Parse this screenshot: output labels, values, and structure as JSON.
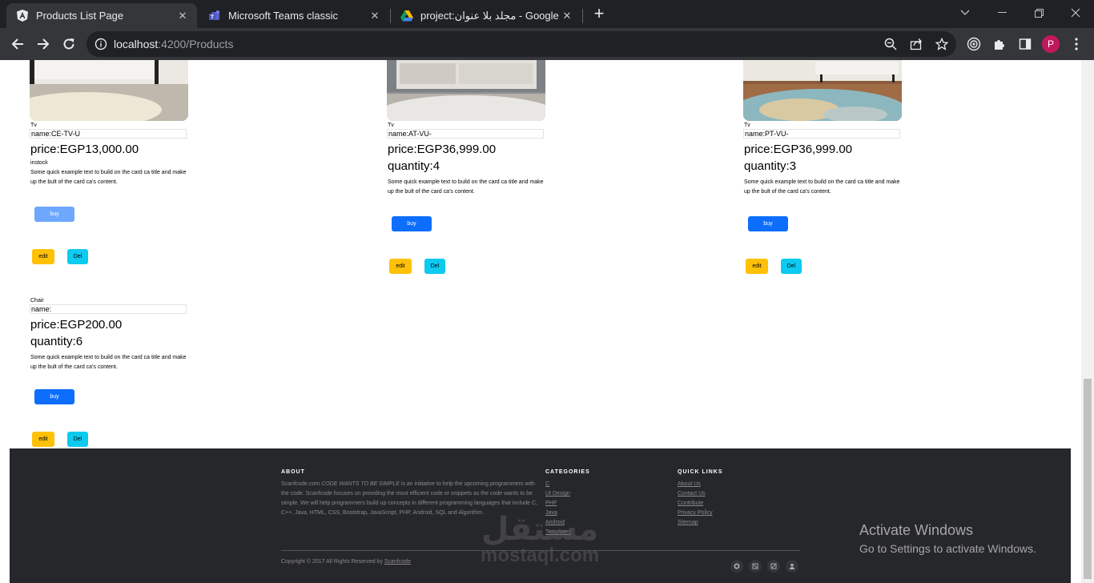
{
  "browser": {
    "tabs": [
      {
        "title": "Products List Page",
        "favicon": "angular-icon",
        "active": true
      },
      {
        "title": "Microsoft Teams classic",
        "favicon": "teams-icon",
        "active": false
      },
      {
        "title": "project:مجلد بلا عنوان - Google Dr",
        "favicon": "google-drive-icon",
        "active": false
      }
    ],
    "url_host": "localhost",
    "url_rest": ":4200/Products",
    "profile_initial": "P"
  },
  "products": [
    {
      "category": "Tv",
      "name": "name:CE-TV-U",
      "price": "price:EGP13,000.00",
      "quantity": "",
      "stock": "instock",
      "description": "Some quick example text to build on the card ca title and make up the bult of the card ca's content.",
      "buy_label": "buy",
      "edit_label": "edit",
      "del_label": "Del"
    },
    {
      "category": "Tv",
      "name": "name:AT-VU-",
      "price": "price:EGP36,999.00",
      "quantity": "quantity:4",
      "stock": "",
      "description": "Some quick example text to build on the card ca title and make up the bult of the card ca's content.",
      "buy_label": "buy",
      "edit_label": "edit",
      "del_label": "Del"
    },
    {
      "category": "Tv",
      "name": "name:PT-VU-",
      "price": "price:EGP36,999.00",
      "quantity": "quantity:3",
      "stock": "",
      "description": "Some quick example text to build on the card ca title and make up the bult of the card ca's content.",
      "buy_label": "buy",
      "edit_label": "edit",
      "del_label": "Del"
    },
    {
      "category": "Chair",
      "name": "name:",
      "price": "price:EGP200.00",
      "quantity": "quantity:6",
      "stock": "",
      "description": "Some quick example text to build on the card ca title and make up the bult of the card ca's content.",
      "buy_label": "buy",
      "edit_label": "edit",
      "del_label": "Del"
    }
  ],
  "footer": {
    "about_heading": "ABOUT",
    "about_text_1": "Scanfcode.com ",
    "about_text_em": "CODE WANTS TO BE SIMPLE",
    "about_text_2": " is an initiative to help the upcoming programmers with the code. Scanfcode focuses on providing the most efficient code or snippets as the code wants to be simple. We will help programmers build up concepts in different programming languages that include C, C++, Java, HTML, CSS, Bootstrap, JavaScript, PHP, Android, SQL and Algorithm.",
    "categories_heading": "CATEGORIES",
    "categories": [
      "C",
      "UI Design",
      "PHP",
      "Java",
      "Android",
      "Templates"
    ],
    "quicklinks_heading": "QUICK LINKS",
    "quicklinks": [
      "About Us",
      "Contact Us",
      "Contribute",
      "Privacy Policy",
      "Sitemap"
    ],
    "copyright": "Copyright © 2017 All Rights Reserved by ",
    "copyright_link": "Scanfcode"
  },
  "windows_notice": {
    "title": "Activate Windows",
    "subtitle": "Go to Settings to activate Windows."
  },
  "watermark": {
    "arabic": "مستقل",
    "latin": "mostaql.com"
  }
}
